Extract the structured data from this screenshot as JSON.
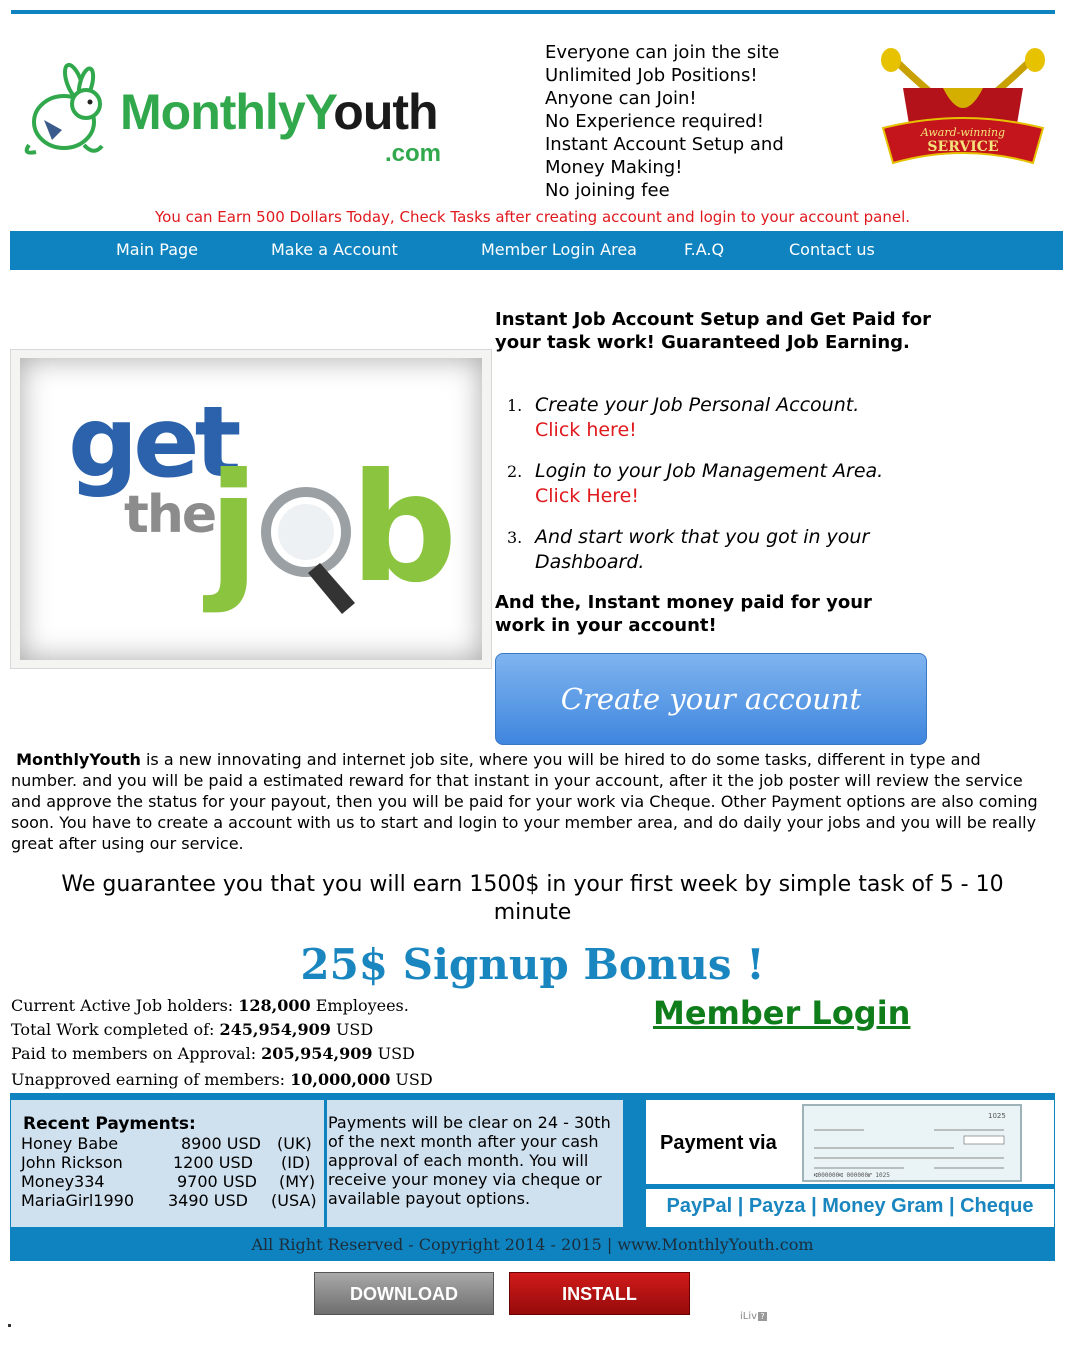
{
  "header": {
    "logo_text_part1": "Monthly",
    "logo_text_part2": "Y",
    "logo_text_part3": "outh",
    "logo_com": ".com",
    "features": [
      "Everyone can join the site",
      "Unlimited Job Positions!",
      "Anyone can Join!",
      "No Experience required!",
      "Instant Account Setup and",
      "Money Making!",
      "No joining fee"
    ],
    "award_text_1": "Award-winning",
    "award_text_2": "SERVICE",
    "earn_banner": "You can Earn 500 Dollars Today, Check Tasks after creating account and login to your account panel."
  },
  "nav": {
    "items": [
      "Main Page",
      "Make a Account",
      "Member Login Area",
      "F.A.Q",
      "Contact us"
    ]
  },
  "hero": {
    "image_get": "get",
    "image_the": "the",
    "image_j": "j",
    "image_b": "b",
    "instructions_title": "Instant Job Account Setup and Get Paid for your task work! Guaranteed Job Earning.",
    "steps": [
      {
        "num": "1.",
        "text": "Create your Job Personal Account.",
        "link": "Click here!"
      },
      {
        "num": "2.",
        "text": "Login to your Job Management Area.",
        "link": "Click Here!"
      },
      {
        "num": "3.",
        "text": "And start work that you got in your Dashboard.",
        "link": ""
      }
    ],
    "instant_paid": "And the, Instant money paid for your work in your account!",
    "create_button": "Create your account"
  },
  "about": {
    "brand": "MonthlyYouth",
    "text": " is a new innovating and internet job site, where you will be hired to do some tasks, different in type and number. and you will be paid a estimated reward for that instant in your account, after it the job poster will review the service and approve the status for your payout, then you will be paid for your work via Cheque. Other Payment options are also coming soon. You have to create a account with us to start and login to your member area, and do daily your jobs and you will be really great after using our service."
  },
  "guarantee": "We guarantee you that you will earn 1500$ in your first week by simple task of 5 - 10 minute",
  "bonus": "25$ Signup Bonus !",
  "stats": [
    {
      "label": "Current Active Job holders: ",
      "value": "128,000",
      "suffix": " Employees."
    },
    {
      "label": "Total Work completed of:  ",
      "value": "245,954,909",
      "suffix": " USD"
    },
    {
      "label": "Paid to members on Approval: ",
      "value": "205,954,909",
      "suffix": " USD"
    },
    {
      "label": "Unapproved earning of members: ",
      "value": "10,000,000",
      "suffix": " USD"
    }
  ],
  "member_login": "Member Login",
  "payments": {
    "title": "Recent Payments:",
    "rows": [
      {
        "name": "Honey Babe",
        "amount": "8900 USD",
        "country": "(UK)"
      },
      {
        "name": "John Rickson",
        "amount": "1200 USD",
        "country": "(ID)"
      },
      {
        "name": "Money334",
        "amount": "9700 USD",
        "country": "(MY)"
      },
      {
        "name": "MariaGirl1990",
        "amount": "3490 USD",
        "country": "(USA)"
      }
    ],
    "note": "Payments will be clear on 24 - 30th of the next month after your cash approval of each month. You will receive your money via cheque or available payout options.",
    "via_label": "Payment via",
    "cheque_number": "1025",
    "methods": "PayPal | Payza | Money Gram | Cheque"
  },
  "footer": {
    "copyright": "All Right Reserved - Copyright 2014 - 2015 | www.MonthlyYouth.com",
    "download": "DOWNLOAD",
    "install": "INSTALL",
    "ilivid": "iLiv"
  },
  "colors": {
    "accent_blue": "#0f83bf",
    "brand_green": "#31a84c",
    "link_red": "#e0191d",
    "login_green": "#0f7d1a"
  }
}
